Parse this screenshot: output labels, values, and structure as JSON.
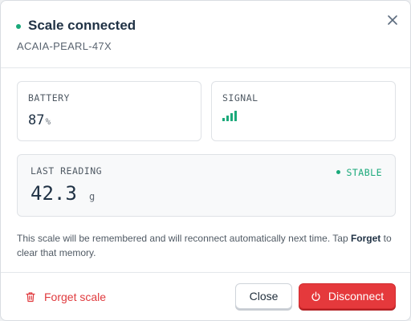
{
  "header": {
    "title": "Scale connected",
    "device_name": "ACAIA-PEARL-47X"
  },
  "stats": {
    "battery": {
      "label": "BATTERY",
      "value": "87",
      "unit": "%"
    },
    "signal": {
      "label": "SIGNAL",
      "bars": 4,
      "max_bars": 4
    }
  },
  "reading": {
    "label": "LAST READING",
    "value": "42.3",
    "unit": "g",
    "status": "STABLE"
  },
  "note": {
    "text_before": "This scale will be remembered and will reconnect automatically next time. Tap ",
    "link": "Forget",
    "text_after": " to clear that memory."
  },
  "footer": {
    "forget_label": "Forget scale",
    "close_label": "Close",
    "disconnect_label": "Disconnect"
  },
  "colors": {
    "accent_green": "#1aa97a",
    "danger_red": "#e5393c"
  },
  "icons": {
    "close": "close-icon",
    "signal": "signal-bars-icon",
    "trash": "trash-icon",
    "power": "power-icon"
  }
}
